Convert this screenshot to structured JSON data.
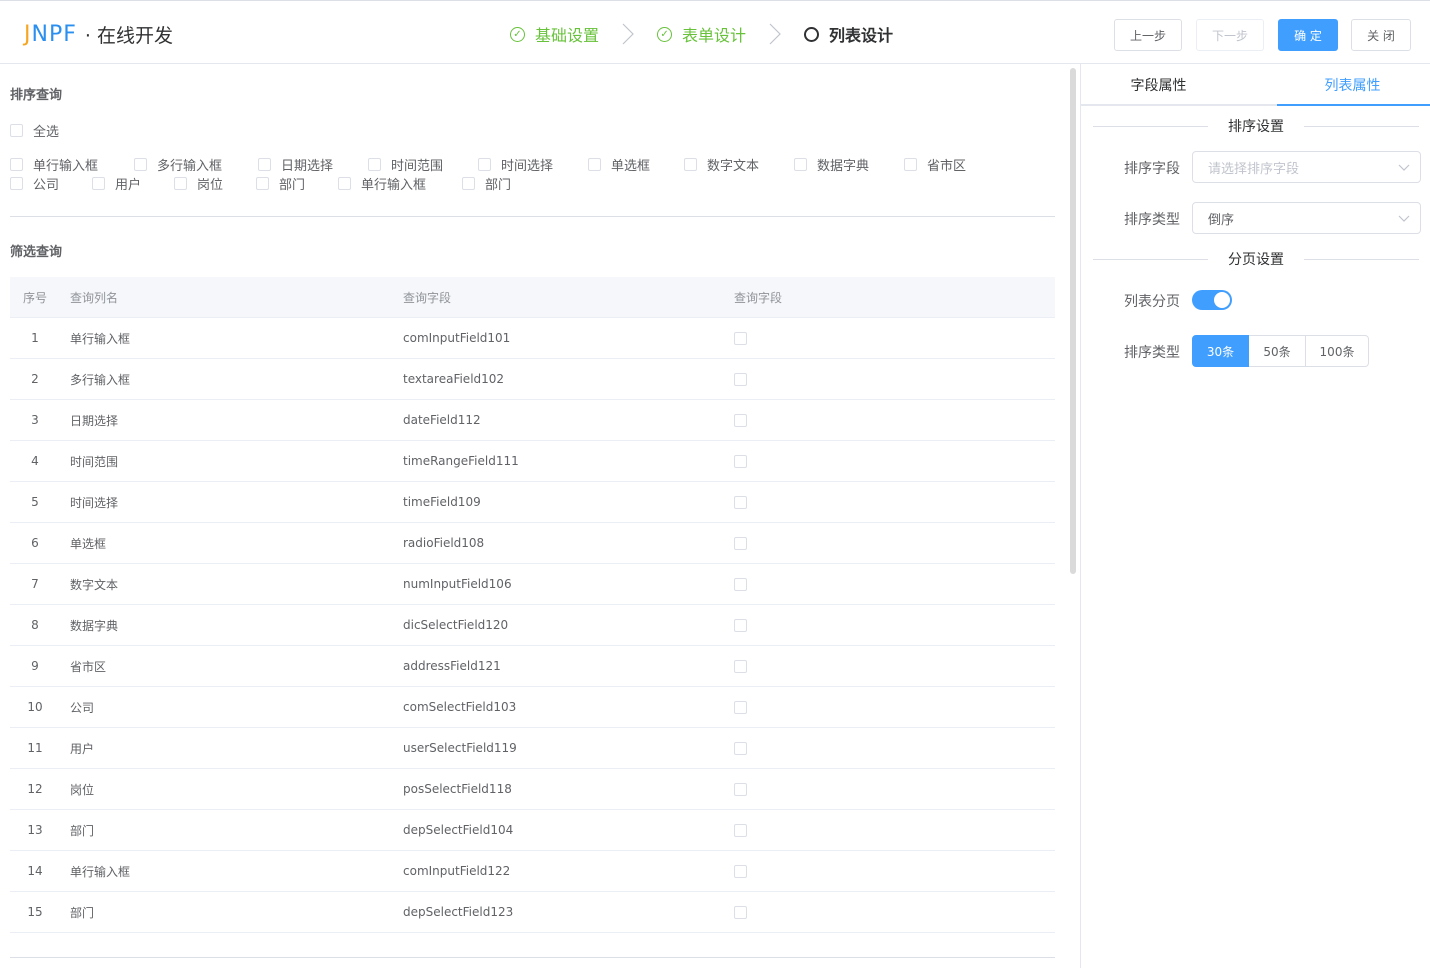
{
  "header": {
    "logo_text_j": "J",
    "logo_text_rest": "NPF",
    "title": "· 在线开发",
    "steps": [
      {
        "label": "基础设置",
        "state": "done"
      },
      {
        "label": "表单设计",
        "state": "done"
      },
      {
        "label": "列表设计",
        "state": "active"
      }
    ],
    "buttons": {
      "prev": "上一步",
      "next": "下一步",
      "confirm": "确 定",
      "close": "关 闭"
    }
  },
  "sort_query": {
    "title": "排序查询",
    "select_all": "全选",
    "row1": [
      "单行输入框",
      "多行输入框",
      "日期选择",
      "时间范围",
      "时间选择",
      "单选框",
      "数字文本",
      "数据字典",
      "省市区"
    ],
    "row2": [
      "公司",
      "用户",
      "岗位",
      "部门",
      "单行输入框",
      "部门"
    ]
  },
  "filter_query": {
    "title": "筛选查询",
    "columns": [
      "序号",
      "查询列名",
      "查询字段",
      "查询字段"
    ],
    "rows": [
      {
        "no": "1",
        "name": "单行输入框",
        "field": "comInputField101"
      },
      {
        "no": "2",
        "name": "多行输入框",
        "field": "textareaField102"
      },
      {
        "no": "3",
        "name": "日期选择",
        "field": "dateField112"
      },
      {
        "no": "4",
        "name": "时间范围",
        "field": "timeRangeField111"
      },
      {
        "no": "5",
        "name": "时间选择",
        "field": "timeField109"
      },
      {
        "no": "6",
        "name": "单选框",
        "field": "radioField108"
      },
      {
        "no": "7",
        "name": "数字文本",
        "field": "numInputField106"
      },
      {
        "no": "8",
        "name": "数据字典",
        "field": "dicSelectField120"
      },
      {
        "no": "9",
        "name": "省市区",
        "field": "addressField121"
      },
      {
        "no": "10",
        "name": "公司",
        "field": "comSelectField103"
      },
      {
        "no": "11",
        "name": "用户",
        "field": "userSelectField119"
      },
      {
        "no": "12",
        "name": "岗位",
        "field": "posSelectField118"
      },
      {
        "no": "13",
        "name": "部门",
        "field": "depSelectField104"
      },
      {
        "no": "14",
        "name": "单行输入框",
        "field": "comInputField122"
      },
      {
        "no": "15",
        "name": "部门",
        "field": "depSelectField123"
      }
    ]
  },
  "right_panel": {
    "tabs": [
      "字段属性",
      "列表属性"
    ],
    "active_tab": "列表属性",
    "sort_settings_title": "排序设置",
    "sort_field_label": "排序字段",
    "sort_field_placeholder": "请选择排序字段",
    "sort_type_label": "排序类型",
    "sort_type_value": "倒序",
    "page_settings_title": "分页设置",
    "paging_label": "列表分页",
    "paging_enabled": true,
    "page_size_label": "排序类型",
    "page_sizes": [
      "30条",
      "50条",
      "100条"
    ],
    "page_size_selected": "30条"
  },
  "colors": {
    "primary": "#409eff",
    "success": "#67c23a",
    "logo_orange": "#f5a623",
    "logo_blue": "#2b8ff0"
  }
}
